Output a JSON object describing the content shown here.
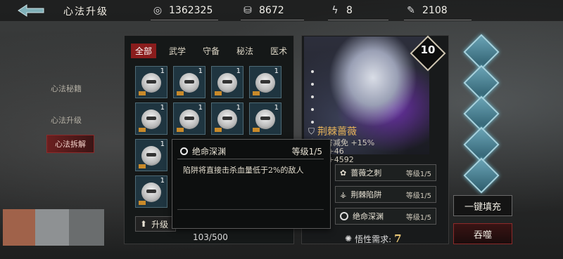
{
  "header": {
    "title": "心法升级",
    "currencies": [
      {
        "icon": "coin-icon",
        "value": "1362325"
      },
      {
        "icon": "ingot-icon",
        "value": "8672"
      },
      {
        "icon": "lightning-icon",
        "value": "8"
      },
      {
        "icon": "ticket-icon",
        "value": "2108"
      }
    ]
  },
  "left_menu": {
    "items": [
      "心法秘籍",
      "心法升级",
      "心法拆解"
    ],
    "active": "心法拆解"
  },
  "inventory": {
    "tabs": [
      "全部",
      "武学",
      "守备",
      "秘法",
      "医术"
    ],
    "active_tab": "全部",
    "cell_count_label": "1",
    "upgrade_button": "升级",
    "count": "103/500"
  },
  "hero": {
    "level": "10",
    "name": "荆棘蔷薇",
    "stats": [
      "免伤害减免 +15%",
      "防御 +46",
      "生命 +4592"
    ],
    "skills": [
      {
        "name": "蔷薇之刺",
        "level": "等级1/5"
      },
      {
        "name": "荆棘陷阱",
        "level": "等级1/5"
      },
      {
        "name": "绝命深渊",
        "level": "等级1/5"
      }
    ],
    "requirement_label": "悟性需求:",
    "requirement_value": "7"
  },
  "actions": {
    "autofill": "一键填充",
    "devour": "吞噬"
  },
  "tooltip": {
    "title": "绝命深渊",
    "level": "等级1/5",
    "desc_prefix": "陷阱将直接击杀血量低于",
    "desc_pct": "2%",
    "desc_suffix": "的敌人"
  },
  "colors": {
    "accent_red": "#8a1d1d",
    "hero_name": "#e6b35a",
    "slot_cyan": "#6aa3b5"
  }
}
